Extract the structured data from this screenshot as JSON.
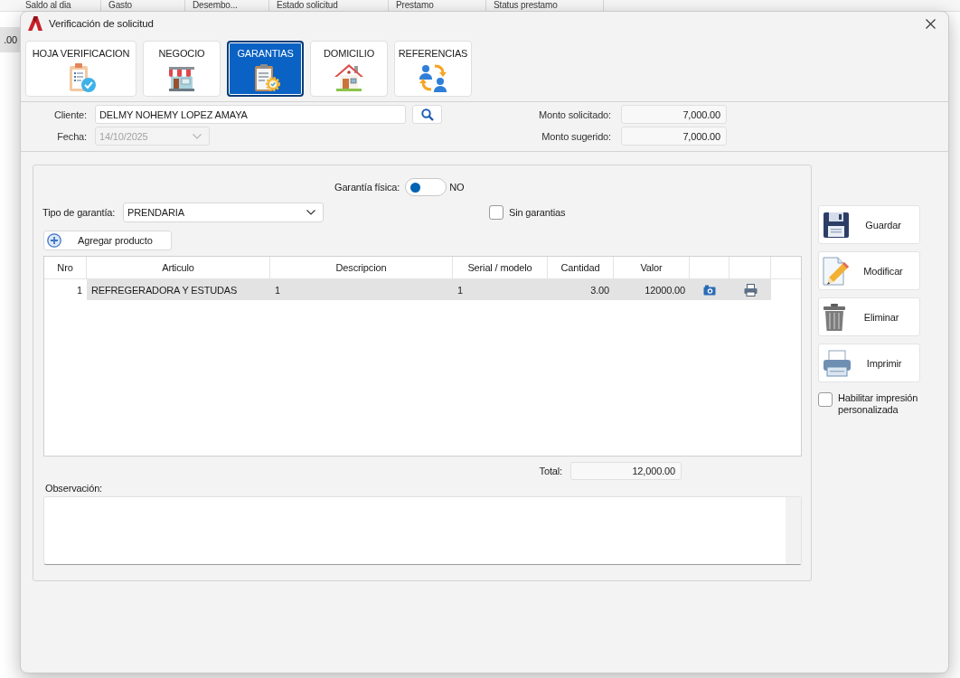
{
  "background_table": {
    "columns": [
      "Saldo al dia",
      "Gasto",
      "Desembo...",
      "Estado solicitud",
      "Prestamo",
      "Status prestamo"
    ],
    "visible_cell": ".00"
  },
  "window": {
    "title": "Verificación de solicitud"
  },
  "tabs": [
    {
      "label": "HOJA VERIFICACION",
      "selected": false
    },
    {
      "label": "NEGOCIO",
      "selected": false
    },
    {
      "label": "GARANTIAS",
      "selected": true
    },
    {
      "label": "DOMICILIO",
      "selected": false
    },
    {
      "label": "REFERENCIAS",
      "selected": false
    }
  ],
  "client": {
    "cliente": {
      "label": "Cliente:",
      "value": "DELMY NOHEMY LOPEZ AMAYA"
    },
    "fecha": {
      "label": "Fecha:",
      "value": "14/10/2025",
      "disabled": true
    },
    "monto_solicitado": {
      "label": "Monto solicitado:",
      "value": "7,000.00"
    },
    "monto_sugerido": {
      "label": "Monto sugerido:",
      "value": "7,000.00"
    }
  },
  "guarantee": {
    "garantia_fisica": {
      "label": "Garantía física:",
      "on": false,
      "state_text": "NO"
    },
    "tipo_garantia": {
      "label": "Tipo de garantía:",
      "value": "PRENDARIA"
    },
    "sin_garantias": {
      "label": "Sin garantias",
      "checked": false
    },
    "add_button": "Agregar producto",
    "table": {
      "columns": [
        "Nro",
        "Articulo",
        "Descripcion",
        "Serial / modelo",
        "Cantidad",
        "Valor"
      ],
      "rows": [
        {
          "cells": [
            "1",
            "REFREGERADORA Y ESTUDAS",
            "1",
            "1",
            "3.00",
            "12000.00"
          ],
          "selected": true
        }
      ]
    },
    "total": {
      "label": "Total:",
      "value": "12,000.00"
    },
    "observacion": {
      "label": "Observación:"
    }
  },
  "actions": [
    {
      "label": "Guardar"
    },
    {
      "label": "Modificar"
    },
    {
      "label": "Eliminar"
    },
    {
      "label": "Imprimir"
    }
  ],
  "custom_print": {
    "label": "Habilitar impresión personalizada",
    "checked": false
  }
}
